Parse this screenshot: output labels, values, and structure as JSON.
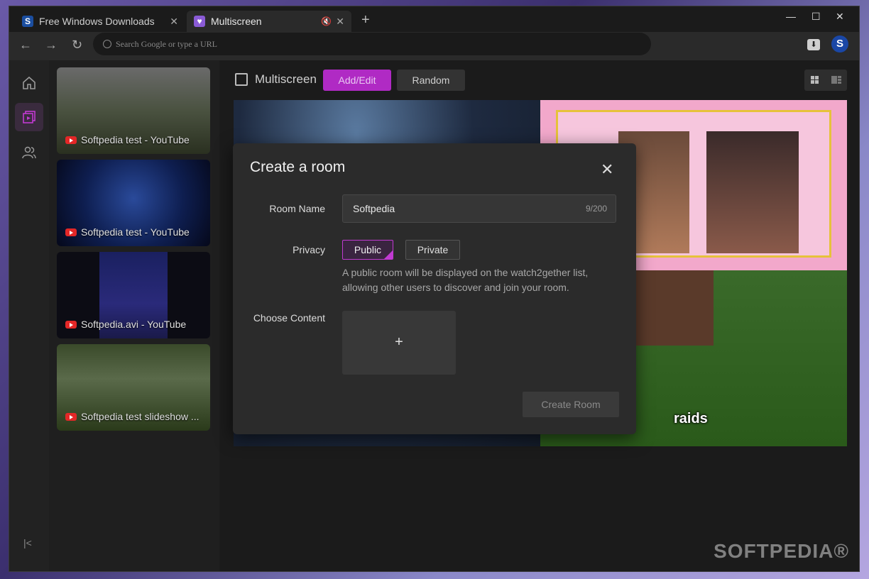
{
  "tabs": [
    {
      "title": "Free Windows Downloads",
      "icon": "softpedia-favicon"
    },
    {
      "title": "Multiscreen",
      "icon": "multiscreen-favicon"
    }
  ],
  "address_bar": {
    "placeholder": "Search Google or type a URL"
  },
  "profile_initial": "S",
  "playlist": [
    {
      "title": "Softpedia test - YouTube"
    },
    {
      "title": "Softpedia test - YouTube"
    },
    {
      "title": "Softpedia.avi - YouTube"
    },
    {
      "title": "Softpedia test slideshow ..."
    }
  ],
  "toolbar": {
    "title": "Multiscreen",
    "add_edit": "Add/Edit",
    "random": "Random"
  },
  "video_caption": "raids",
  "watermark": "SOFTPEDIA®",
  "dialog": {
    "title": "Create a room",
    "room_name_label": "Room Name",
    "room_name_value": "Softpedia",
    "room_name_counter": "9/200",
    "privacy_label": "Privacy",
    "public": "Public",
    "private": "Private",
    "privacy_description": "A public room will be displayed on the watch2gether list, allowing other users to discover and join your room.",
    "content_label": "Choose Content",
    "content_add": "+",
    "create_button": "Create Room"
  },
  "colors": {
    "accent": "#b02ac4",
    "background": "#1f1f1f"
  }
}
